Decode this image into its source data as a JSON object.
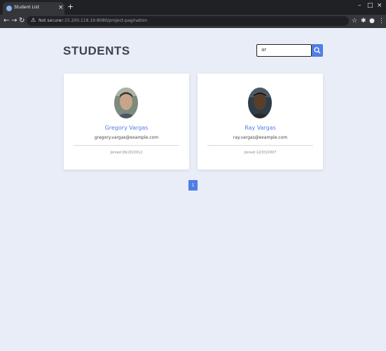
{
  "browser": {
    "tab_title": "Student List",
    "tab_close": "×",
    "new_tab": "+",
    "window_controls": {
      "minimize": "–",
      "maximize": "□",
      "close": "×"
    },
    "nav": {
      "back": "←",
      "forward": "→",
      "reload": "↻"
    },
    "address": {
      "warning": "⚠",
      "secure_label": "Not secure",
      "url": "ar:15.200.118.19:8080/project-pagination"
    }
  },
  "page": {
    "title": "STUDENTS",
    "search": {
      "value": "ar"
    }
  },
  "students": [
    {
      "name": "Gregory Vargas",
      "email": "gregory.vargas@example.com",
      "joined": "Joined 06/20/2012"
    },
    {
      "name": "Ray Vargas",
      "email": "ray.vargas@example.com",
      "joined": "Joined 12/03/2007"
    }
  ],
  "pagination": {
    "pages": [
      "1"
    ],
    "current": "1"
  },
  "colors": {
    "accent": "#4f7ee8",
    "background": "#e8edf7",
    "title": "#3d4450"
  }
}
